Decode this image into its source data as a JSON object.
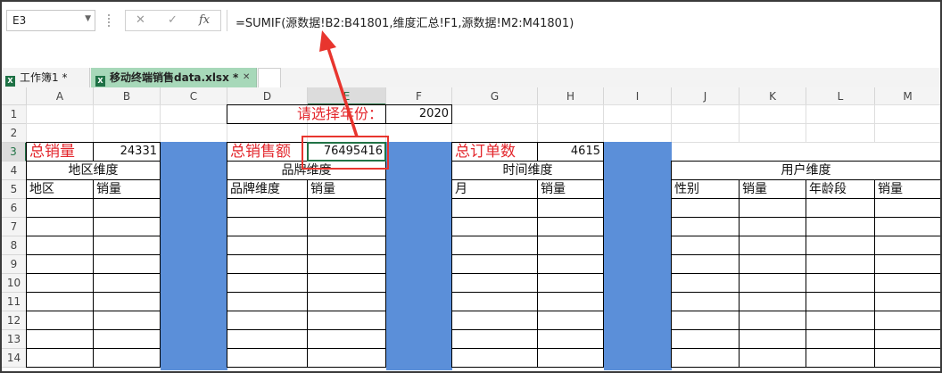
{
  "name_box": "E3",
  "formula_icons": {
    "cancel": "✕",
    "enter": "✓",
    "fx": "fx"
  },
  "formula": "=SUMIF(源数据!B2:B41801,维度汇总!F1,源数据!M2:M41801)",
  "tabs": [
    {
      "label": "工作簿1 *"
    },
    {
      "label": "移动终端销售data.xlsx *",
      "close": "✕"
    }
  ],
  "columns": [
    "A",
    "B",
    "C",
    "D",
    "E",
    "F",
    "G",
    "H",
    "I",
    "J",
    "K",
    "L",
    "M"
  ],
  "rows": [
    "1",
    "2",
    "3",
    "4",
    "5",
    "6",
    "7",
    "8",
    "9",
    "10",
    "11",
    "12",
    "13",
    "14"
  ],
  "cells": {
    "D1": "请选择年份：",
    "F1": "2020",
    "A3": "总销量",
    "B3": "24331",
    "D3": "总销售额",
    "E3": "76495416",
    "G3": "总订单数",
    "H3": "4615",
    "A4": "地区维度",
    "D4": "品牌维度",
    "G4": "时间维度",
    "J4": "用户维度",
    "A5": "地区",
    "B5": "销量",
    "D5": "品牌维度",
    "E5": "销量",
    "G5": "月",
    "H5": "销量",
    "J5": "性别",
    "K5": "销量",
    "L5": "年龄段",
    "M5": "销量"
  },
  "colors": {
    "accent_red": "#e3262c",
    "blue_fill": "#5b8fd9",
    "active_tab": "#a7d8b9",
    "selection": "#217346"
  }
}
